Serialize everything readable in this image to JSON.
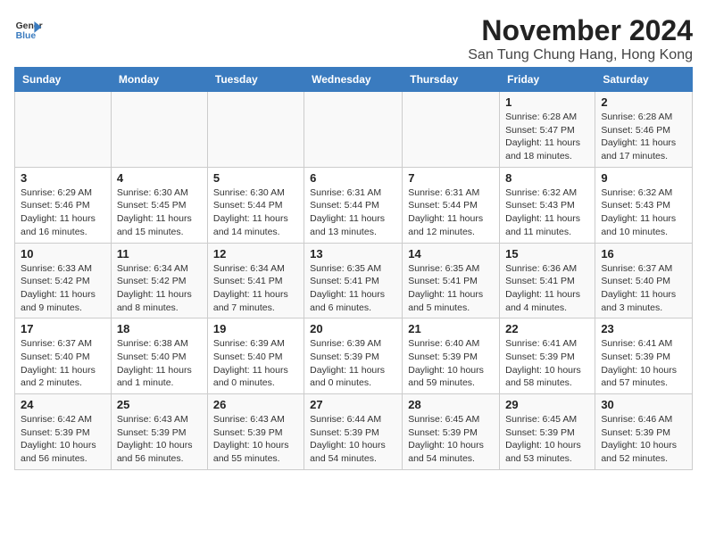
{
  "header": {
    "logo_line1": "General",
    "logo_line2": "Blue",
    "month": "November 2024",
    "location": "San Tung Chung Hang, Hong Kong"
  },
  "weekdays": [
    "Sunday",
    "Monday",
    "Tuesday",
    "Wednesday",
    "Thursday",
    "Friday",
    "Saturday"
  ],
  "weeks": [
    [
      {
        "day": "",
        "sunrise": "",
        "sunset": "",
        "daylight": ""
      },
      {
        "day": "",
        "sunrise": "",
        "sunset": "",
        "daylight": ""
      },
      {
        "day": "",
        "sunrise": "",
        "sunset": "",
        "daylight": ""
      },
      {
        "day": "",
        "sunrise": "",
        "sunset": "",
        "daylight": ""
      },
      {
        "day": "",
        "sunrise": "",
        "sunset": "",
        "daylight": ""
      },
      {
        "day": "1",
        "sunrise": "Sunrise: 6:28 AM",
        "sunset": "Sunset: 5:47 PM",
        "daylight": "Daylight: 11 hours and 18 minutes."
      },
      {
        "day": "2",
        "sunrise": "Sunrise: 6:28 AM",
        "sunset": "Sunset: 5:46 PM",
        "daylight": "Daylight: 11 hours and 17 minutes."
      }
    ],
    [
      {
        "day": "3",
        "sunrise": "Sunrise: 6:29 AM",
        "sunset": "Sunset: 5:46 PM",
        "daylight": "Daylight: 11 hours and 16 minutes."
      },
      {
        "day": "4",
        "sunrise": "Sunrise: 6:30 AM",
        "sunset": "Sunset: 5:45 PM",
        "daylight": "Daylight: 11 hours and 15 minutes."
      },
      {
        "day": "5",
        "sunrise": "Sunrise: 6:30 AM",
        "sunset": "Sunset: 5:44 PM",
        "daylight": "Daylight: 11 hours and 14 minutes."
      },
      {
        "day": "6",
        "sunrise": "Sunrise: 6:31 AM",
        "sunset": "Sunset: 5:44 PM",
        "daylight": "Daylight: 11 hours and 13 minutes."
      },
      {
        "day": "7",
        "sunrise": "Sunrise: 6:31 AM",
        "sunset": "Sunset: 5:44 PM",
        "daylight": "Daylight: 11 hours and 12 minutes."
      },
      {
        "day": "8",
        "sunrise": "Sunrise: 6:32 AM",
        "sunset": "Sunset: 5:43 PM",
        "daylight": "Daylight: 11 hours and 11 minutes."
      },
      {
        "day": "9",
        "sunrise": "Sunrise: 6:32 AM",
        "sunset": "Sunset: 5:43 PM",
        "daylight": "Daylight: 11 hours and 10 minutes."
      }
    ],
    [
      {
        "day": "10",
        "sunrise": "Sunrise: 6:33 AM",
        "sunset": "Sunset: 5:42 PM",
        "daylight": "Daylight: 11 hours and 9 minutes."
      },
      {
        "day": "11",
        "sunrise": "Sunrise: 6:34 AM",
        "sunset": "Sunset: 5:42 PM",
        "daylight": "Daylight: 11 hours and 8 minutes."
      },
      {
        "day": "12",
        "sunrise": "Sunrise: 6:34 AM",
        "sunset": "Sunset: 5:41 PM",
        "daylight": "Daylight: 11 hours and 7 minutes."
      },
      {
        "day": "13",
        "sunrise": "Sunrise: 6:35 AM",
        "sunset": "Sunset: 5:41 PM",
        "daylight": "Daylight: 11 hours and 6 minutes."
      },
      {
        "day": "14",
        "sunrise": "Sunrise: 6:35 AM",
        "sunset": "Sunset: 5:41 PM",
        "daylight": "Daylight: 11 hours and 5 minutes."
      },
      {
        "day": "15",
        "sunrise": "Sunrise: 6:36 AM",
        "sunset": "Sunset: 5:41 PM",
        "daylight": "Daylight: 11 hours and 4 minutes."
      },
      {
        "day": "16",
        "sunrise": "Sunrise: 6:37 AM",
        "sunset": "Sunset: 5:40 PM",
        "daylight": "Daylight: 11 hours and 3 minutes."
      }
    ],
    [
      {
        "day": "17",
        "sunrise": "Sunrise: 6:37 AM",
        "sunset": "Sunset: 5:40 PM",
        "daylight": "Daylight: 11 hours and 2 minutes."
      },
      {
        "day": "18",
        "sunrise": "Sunrise: 6:38 AM",
        "sunset": "Sunset: 5:40 PM",
        "daylight": "Daylight: 11 hours and 1 minute."
      },
      {
        "day": "19",
        "sunrise": "Sunrise: 6:39 AM",
        "sunset": "Sunset: 5:40 PM",
        "daylight": "Daylight: 11 hours and 0 minutes."
      },
      {
        "day": "20",
        "sunrise": "Sunrise: 6:39 AM",
        "sunset": "Sunset: 5:39 PM",
        "daylight": "Daylight: 11 hours and 0 minutes."
      },
      {
        "day": "21",
        "sunrise": "Sunrise: 6:40 AM",
        "sunset": "Sunset: 5:39 PM",
        "daylight": "Daylight: 10 hours and 59 minutes."
      },
      {
        "day": "22",
        "sunrise": "Sunrise: 6:41 AM",
        "sunset": "Sunset: 5:39 PM",
        "daylight": "Daylight: 10 hours and 58 minutes."
      },
      {
        "day": "23",
        "sunrise": "Sunrise: 6:41 AM",
        "sunset": "Sunset: 5:39 PM",
        "daylight": "Daylight: 10 hours and 57 minutes."
      }
    ],
    [
      {
        "day": "24",
        "sunrise": "Sunrise: 6:42 AM",
        "sunset": "Sunset: 5:39 PM",
        "daylight": "Daylight: 10 hours and 56 minutes."
      },
      {
        "day": "25",
        "sunrise": "Sunrise: 6:43 AM",
        "sunset": "Sunset: 5:39 PM",
        "daylight": "Daylight: 10 hours and 56 minutes."
      },
      {
        "day": "26",
        "sunrise": "Sunrise: 6:43 AM",
        "sunset": "Sunset: 5:39 PM",
        "daylight": "Daylight: 10 hours and 55 minutes."
      },
      {
        "day": "27",
        "sunrise": "Sunrise: 6:44 AM",
        "sunset": "Sunset: 5:39 PM",
        "daylight": "Daylight: 10 hours and 54 minutes."
      },
      {
        "day": "28",
        "sunrise": "Sunrise: 6:45 AM",
        "sunset": "Sunset: 5:39 PM",
        "daylight": "Daylight: 10 hours and 54 minutes."
      },
      {
        "day": "29",
        "sunrise": "Sunrise: 6:45 AM",
        "sunset": "Sunset: 5:39 PM",
        "daylight": "Daylight: 10 hours and 53 minutes."
      },
      {
        "day": "30",
        "sunrise": "Sunrise: 6:46 AM",
        "sunset": "Sunset: 5:39 PM",
        "daylight": "Daylight: 10 hours and 52 minutes."
      }
    ]
  ]
}
